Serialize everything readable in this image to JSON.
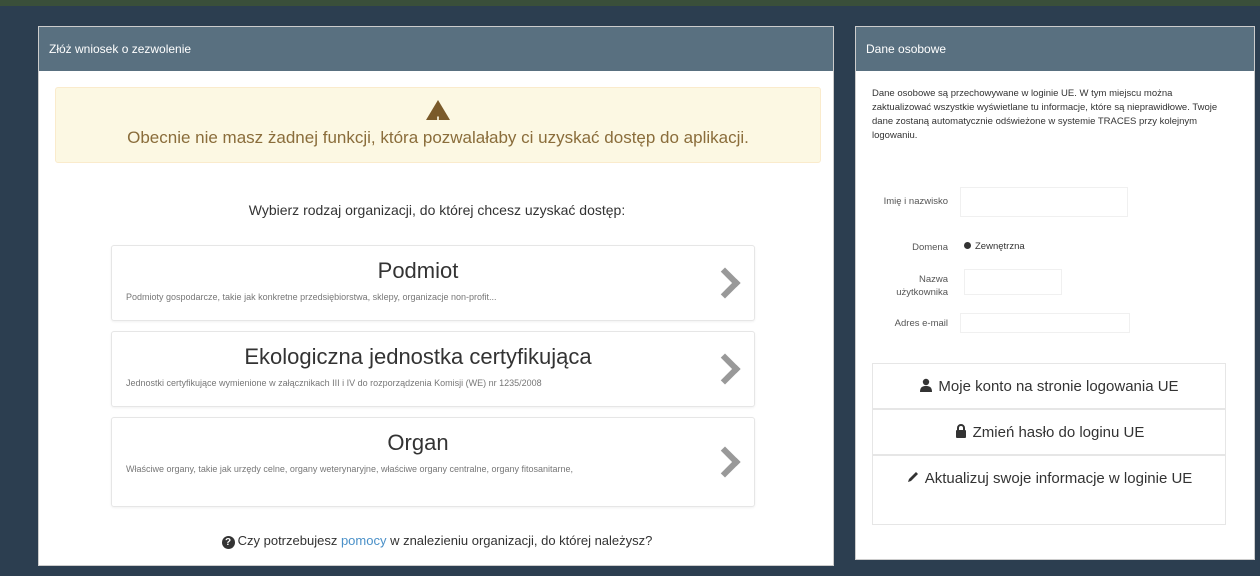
{
  "left_panel": {
    "heading": "Złóż wniosek o zezwolenie",
    "warning_text": "Obecnie nie masz żadnej funkcji, która pozwalałaby ci uzyskać dostęp do aplikacji.",
    "choose_text": "Wybierz rodzaj organizacji, do której chcesz uzyskać dostęp:",
    "cards": [
      {
        "title": "Podmiot",
        "description": "Podmioty gospodarcze, takie jak konkretne przedsiębiorstwa, sklepy, organizacje non-profit..."
      },
      {
        "title": "Ekologiczna jednostka certyfikująca",
        "description": "Jednostki certyfikujące wymienione w załącznikach III i IV do rozporządzenia Komisji (WE) nr 1235/2008"
      },
      {
        "title": "Organ",
        "description": "Właściwe organy, takie jak urzędy celne, organy weterynaryjne, właściwe organy centralne, organy fitosanitarne,"
      }
    ],
    "help_prefix": "Czy potrzebujesz ",
    "help_link": "pomocy",
    "help_suffix": " w znalezieniu organizacji, do której należysz?"
  },
  "right_panel": {
    "heading": "Dane osobowe",
    "info_text": "Dane osobowe są przechowywane w loginie UE. W tym miejscu można zaktualizować wszystkie wyświetlane tu informacje, które są nieprawidłowe. Twoje dane zostaną automatycznie odświeżone w systemie TRACES przy kolejnym logowaniu.",
    "fields": {
      "name_label": "Imię i nazwisko",
      "name_value": "",
      "domain_label": "Domena",
      "domain_value": "Zewnętrzna",
      "username_label": "Nazwa użytkownika",
      "username_value": "",
      "email_label": "Adres e-mail",
      "email_value": ""
    },
    "buttons": {
      "account": "Moje konto na stronie logowania UE",
      "password": "Zmień hasło do loginu UE",
      "update": "Aktualizuj swoje informacje w loginie UE"
    }
  },
  "colors": {
    "background": "#2c3e50",
    "panel_heading": "#597080",
    "warning_bg": "#fcf8e3",
    "warning_text": "#8a6d3b",
    "link": "#4a90c8"
  }
}
